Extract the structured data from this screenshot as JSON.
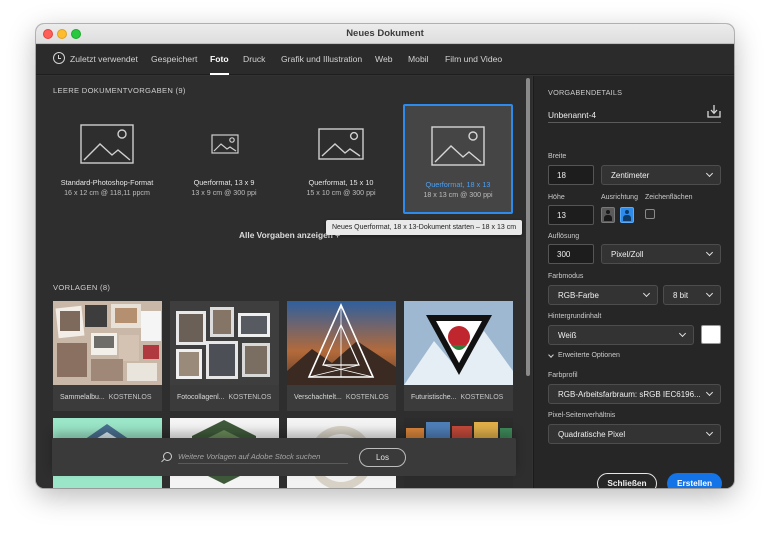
{
  "window": {
    "title": "Neues Dokument"
  },
  "tabs": [
    {
      "label": "Zuletzt verwendet"
    },
    {
      "label": "Gespeichert"
    },
    {
      "label": "Foto",
      "active": true
    },
    {
      "label": "Druck"
    },
    {
      "label": "Grafik und Illustration"
    },
    {
      "label": "Web"
    },
    {
      "label": "Mobil"
    },
    {
      "label": "Film und Video"
    }
  ],
  "blank_presets": {
    "title": "LEERE DOKUMENTVORGABEN (9)",
    "items": [
      {
        "name": "Standard-Photoshop-Format",
        "details": "16 x 12 cm @ 118,11 ppcm",
        "icon": "image-placeholder-icon"
      },
      {
        "name": "Querformat, 13 x 9",
        "details": "13 x 9 cm @ 300 ppi",
        "icon": "image-placeholder-icon"
      },
      {
        "name": "Querformat, 15 x 10",
        "details": "15 x 10 cm @ 300 ppi",
        "icon": "image-placeholder-icon"
      },
      {
        "name": "Querformat, 18 x 13",
        "details": "18 x 13 cm @ 300 ppi",
        "icon": "image-placeholder-icon",
        "selected": true
      }
    ],
    "tooltip": "Neues Querformat, 18 x 13-Dokument starten – 18 x 13 cm",
    "view_all": "Alle Vorgaben anzeigen +"
  },
  "templates": {
    "title": "VORLAGEN (8)",
    "badge": "KOSTENLOS",
    "items": [
      {
        "name": "Sammelalbu..."
      },
      {
        "name": "Fotocollagenl..."
      },
      {
        "name": "Verschachtelt..."
      },
      {
        "name": "Futuristische..."
      },
      {
        "name": ""
      },
      {
        "name": ""
      },
      {
        "name": ""
      },
      {
        "name": ""
      }
    ]
  },
  "search": {
    "placeholder": "Weitere Vorlagen auf Adobe Stock suchen",
    "button": "Los"
  },
  "details": {
    "title": "VORGABENDETAILS",
    "doc_name": "Unbenannt-4",
    "width_label": "Breite",
    "width_value": "18",
    "unit": "Zentimeter",
    "height_label": "Höhe",
    "height_value": "13",
    "orientation_label": "Ausrichtung",
    "orientation": "landscape",
    "artboards_label": "Zeichenflächen",
    "artboards_checked": false,
    "resolution_label": "Auflösung",
    "resolution_value": "300",
    "resolution_unit": "Pixel/Zoll",
    "color_mode_label": "Farbmodus",
    "color_mode": "RGB-Farbe",
    "bit_depth": "8 bit",
    "background_label": "Hintergrundinhalt",
    "background": "Weiß",
    "background_color": "#ffffff",
    "advanced_label": "Erweiterte Optionen",
    "profile_label": "Farbprofil",
    "profile": "RGB-Arbeitsfarbraum: sRGB IEC6196...",
    "pixel_ratio_label": "Pixel-Seitenverhältnis",
    "pixel_ratio": "Quadratische Pixel"
  },
  "actions": {
    "close": "Schließen",
    "create": "Erstellen"
  },
  "colors": {
    "accent": "#1473e6",
    "selection": "#2d8ceb",
    "panel": "#2e2e2e",
    "sidebar": "#262626"
  }
}
